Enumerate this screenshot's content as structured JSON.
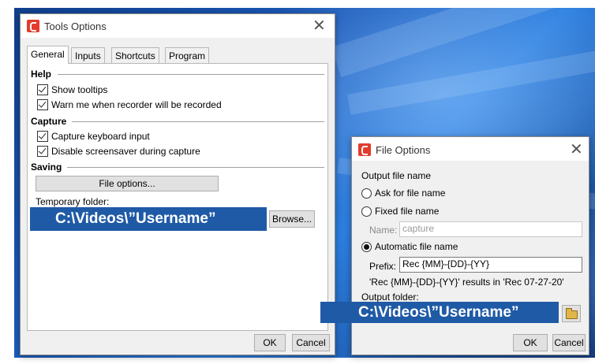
{
  "tools_options": {
    "title": "Tools Options",
    "tabs": [
      "General",
      "Inputs",
      "Shortcuts",
      "Program"
    ],
    "sections": {
      "help": {
        "title": "Help",
        "items": [
          {
            "label": "Show tooltips",
            "checked": true
          },
          {
            "label": "Warn me when recorder will be recorded",
            "checked": true
          }
        ]
      },
      "capture": {
        "title": "Capture",
        "items": [
          {
            "label": "Capture keyboard input",
            "checked": true
          },
          {
            "label": "Disable screensaver during capture",
            "checked": true
          }
        ]
      },
      "saving": {
        "title": "Saving",
        "file_options_label": "File options...",
        "temp_folder_label": "Temporary folder:",
        "temp_folder_value": "C:\\Videos\\”Username”",
        "browse_label": "Browse..."
      }
    },
    "ok_label": "OK",
    "cancel_label": "Cancel"
  },
  "file_options": {
    "title": "File Options",
    "output_file_name_label": "Output file name",
    "radio_ask": "Ask for file name",
    "radio_fixed": "Fixed file name",
    "name_label": "Name:",
    "name_value": "capture",
    "radio_automatic": "Automatic file name",
    "selected": "automatic",
    "prefix_label": "Prefix:",
    "prefix_value": "Rec {MM}-{DD}-{YY}",
    "result_text": "'Rec {MM}-{DD}-{YY}' results in 'Rec 07-27-20'",
    "output_folder_label": "Output folder:",
    "output_folder_value": "C:\\Videos\\”Username”",
    "ok_label": "OK",
    "cancel_label": "Cancel"
  },
  "colors": {
    "accent_blue": "#1f5aa6",
    "app_icon_red": "#e43b2c"
  }
}
